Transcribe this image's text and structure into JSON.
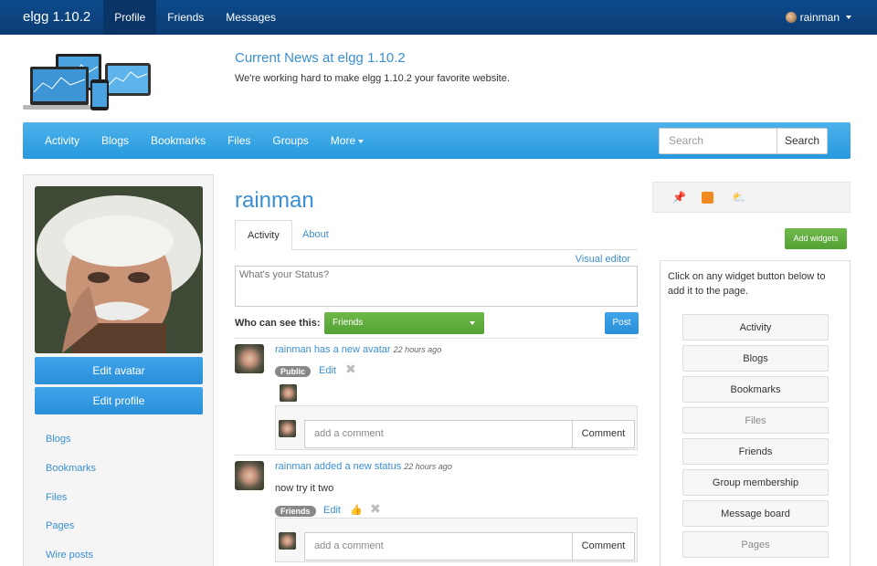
{
  "topbar": {
    "brand": "elgg 1.10.2",
    "nav": [
      {
        "label": "Profile",
        "active": true
      },
      {
        "label": "Friends",
        "active": false
      },
      {
        "label": "Messages",
        "active": false
      }
    ],
    "user": "rainman"
  },
  "header": {
    "title": "Current News at elgg 1.10.2",
    "text": "We're working hard to make elgg 1.10.2 your favorite website."
  },
  "menu": {
    "items": [
      "Activity",
      "Blogs",
      "Bookmarks",
      "Files",
      "Groups"
    ],
    "more": "More",
    "search_placeholder": "Search",
    "search_button": "Search"
  },
  "sidebar": {
    "edit_avatar": "Edit avatar",
    "edit_profile": "Edit profile",
    "links": [
      "Blogs",
      "Bookmarks",
      "Files",
      "Pages",
      "Wire posts"
    ]
  },
  "profile": {
    "name": "rainman",
    "tabs": [
      "Activity",
      "About"
    ],
    "visual_editor": "Visual editor",
    "status_placeholder": "What's your Status?",
    "who_label": "Who can see this:",
    "access_value": "Friends",
    "post_button": "Post"
  },
  "feed": [
    {
      "user": "rainman",
      "action": "has a new avatar",
      "time": "22 hours ago",
      "badge": "Public",
      "edit": "Edit",
      "comment_placeholder": "add a comment",
      "comment_button": "Comment"
    },
    {
      "user": "rainman",
      "action": "added a new status",
      "time": "22 hours ago",
      "text": "now try it two",
      "badge": "Friends",
      "edit": "Edit",
      "comment_placeholder": "add a comment",
      "comment_button": "Comment"
    }
  ],
  "widgets": {
    "add_button": "Add widgets",
    "help": "Click on any widget button below to add it to the page.",
    "buttons": [
      {
        "label": "Activity",
        "disabled": false
      },
      {
        "label": "Blogs",
        "disabled": false
      },
      {
        "label": "Bookmarks",
        "disabled": false
      },
      {
        "label": "Files",
        "disabled": true
      },
      {
        "label": "Friends",
        "disabled": false
      },
      {
        "label": "Group membership",
        "disabled": false
      },
      {
        "label": "Message board",
        "disabled": false
      },
      {
        "label": "Pages",
        "disabled": true
      }
    ]
  },
  "colors": {
    "topbar": "#0d4a8a",
    "menubar": "#2699dd",
    "link": "#3b8fd1",
    "green": "#5aa83a"
  }
}
